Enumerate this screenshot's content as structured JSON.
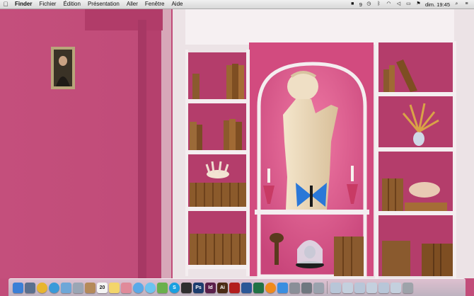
{
  "menubar": {
    "apple_icon": "apple-logo-icon",
    "app_name": "Finder",
    "items": [
      "Fichier",
      "Édition",
      "Présentation",
      "Aller",
      "Fenêtre",
      "Aide"
    ],
    "status": {
      "number_badge": "9",
      "clock": "dim. 19:45"
    }
  },
  "desktop": {
    "wallpaper": "pink-library-bookshelves",
    "colors": {
      "wall": "#c24d7a",
      "shelf": "#f3eef0",
      "niche": "#e25d8e"
    }
  },
  "dock": {
    "items": [
      {
        "name": "finder",
        "color": "#3b7fd6",
        "label": ""
      },
      {
        "name": "launchpad",
        "color": "#5a6f8e",
        "label": ""
      },
      {
        "name": "chrome",
        "color": "#e8b530",
        "label": ""
      },
      {
        "name": "safari",
        "color": "#3a9ad9",
        "label": ""
      },
      {
        "name": "mail",
        "color": "#6fa7d8",
        "label": ""
      },
      {
        "name": "preview",
        "color": "#9aa6b5",
        "label": ""
      },
      {
        "name": "contacts",
        "color": "#b58a5a",
        "label": ""
      },
      {
        "name": "calendar",
        "color": "#f4f4f4",
        "label": "20"
      },
      {
        "name": "notes",
        "color": "#f3d56b",
        "label": ""
      },
      {
        "name": "photos",
        "color": "#e08a9a",
        "label": ""
      },
      {
        "name": "itunes",
        "color": "#5aa9e8",
        "label": ""
      },
      {
        "name": "messages",
        "color": "#6cc3f0",
        "label": ""
      },
      {
        "name": "facetime",
        "color": "#6ab04c",
        "label": ""
      },
      {
        "name": "skype",
        "color": "#1aa0e0",
        "label": "S"
      },
      {
        "name": "terminal",
        "color": "#2f2f2f",
        "label": ""
      },
      {
        "name": "photoshop",
        "color": "#1c3d6e",
        "label": "Ps"
      },
      {
        "name": "indesign",
        "color": "#5a1f4a",
        "label": "Id"
      },
      {
        "name": "illustrator",
        "color": "#4a2a14",
        "label": "Ai"
      },
      {
        "name": "acrobat",
        "color": "#b21d1d",
        "label": ""
      },
      {
        "name": "word",
        "color": "#2b5797",
        "label": ""
      },
      {
        "name": "excel",
        "color": "#207245",
        "label": ""
      },
      {
        "name": "vlc",
        "color": "#f08a1c",
        "label": ""
      },
      {
        "name": "app-store",
        "color": "#3b8ee0",
        "label": ""
      },
      {
        "name": "system-preferences",
        "color": "#8a8f98",
        "label": ""
      },
      {
        "name": "utility",
        "color": "#707880",
        "label": ""
      },
      {
        "name": "image-capture",
        "color": "#9aa2ad",
        "label": ""
      },
      {
        "name": "folder-1",
        "color": "#b8c6d8",
        "label": ""
      },
      {
        "name": "folder-2",
        "color": "#c4d0de",
        "label": ""
      },
      {
        "name": "folder-3",
        "color": "#b8c6d8",
        "label": ""
      },
      {
        "name": "folder-4",
        "color": "#c4d0de",
        "label": ""
      },
      {
        "name": "folder-5",
        "color": "#b8c6d8",
        "label": ""
      },
      {
        "name": "folder-6",
        "color": "#c4d0de",
        "label": ""
      },
      {
        "name": "trash",
        "color": "#9ea3aa",
        "label": ""
      }
    ]
  }
}
